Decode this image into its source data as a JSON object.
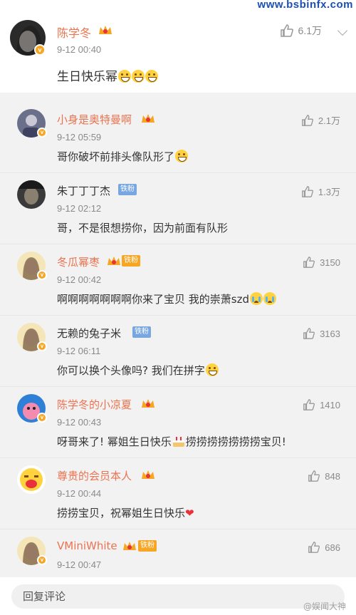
{
  "watermark": {
    "site": "www.bsbinfx.com",
    "bottom": "@娱闻大神"
  },
  "post": {
    "author": "陈学冬",
    "time": "9-12 00:40",
    "text": "生日快乐幂",
    "likes": "6.1万"
  },
  "comments": [
    {
      "name": "小身是奥特曼啊",
      "time": "9-12 05:59",
      "text": "哥你破坏前排头像队形了",
      "likes": "2.1万",
      "badge": "crown",
      "name_color": "orange"
    },
    {
      "name": "朱丁丁丁杰",
      "time": "9-12 02:12",
      "text": "哥，不是很想捞你，因为前面有队形",
      "likes": "1.3万",
      "badge": "铁粉",
      "name_color": "gray"
    },
    {
      "name": "冬瓜幂枣",
      "time": "9-12 00:42",
      "text": "啊啊啊啊啊啊啊你来了宝贝 我的崇萧szd",
      "likes": "3150",
      "badge": "铁粉",
      "name_color": "orange"
    },
    {
      "name": "无赖的兔子米",
      "time": "9-12 06:11",
      "text": "你可以换个头像吗? 我们在拼字",
      "likes": "3163",
      "badge": "铁粉",
      "name_color": "gray"
    },
    {
      "name": "陈学冬的小凉夏",
      "time": "9-12 00:43",
      "text_a": "呀哥来了! 幂姐生日快乐",
      "text_b": "捞捞捞捞捞捞捞宝贝!",
      "likes": "1410",
      "badge": "crown",
      "name_color": "orange"
    },
    {
      "name": "尊贵的会员本人",
      "time": "9-12 00:44",
      "text": "捞捞宝贝，祝幂姐生日快乐",
      "likes": "848",
      "badge": "crown",
      "name_color": "orange"
    },
    {
      "name": "VMiniWhite",
      "time": "9-12 00:47",
      "text": "",
      "likes": "686",
      "badge": "铁粉",
      "name_color": "orange"
    }
  ],
  "reply": {
    "placeholder": "回复评论"
  },
  "colors": {
    "accent": "#eb7350",
    "background": "#f2f2f2",
    "fan_badge": "#78a7e0"
  }
}
